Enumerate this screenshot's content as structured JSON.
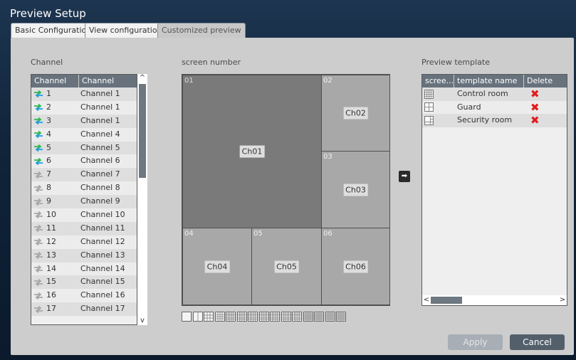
{
  "window": {
    "title": "Preview Setup"
  },
  "tabs": [
    {
      "label": "Basic Configuration",
      "active": false
    },
    {
      "label": "View configuration",
      "active": false
    },
    {
      "label": "Customized preview",
      "active": true
    }
  ],
  "channel_panel": {
    "label": "Channel",
    "columns": [
      "Channel",
      "Channel"
    ],
    "rows": [
      {
        "num": "1",
        "name": "Channel 1",
        "online": true
      },
      {
        "num": "2",
        "name": "Channel 1",
        "online": true
      },
      {
        "num": "3",
        "name": "Channel 1",
        "online": true
      },
      {
        "num": "4",
        "name": "Channel 4",
        "online": true
      },
      {
        "num": "5",
        "name": "Channel 5",
        "online": true
      },
      {
        "num": "6",
        "name": "Channel 6",
        "online": true
      },
      {
        "num": "7",
        "name": "Channel 7",
        "online": false
      },
      {
        "num": "8",
        "name": "Channel 8",
        "online": false
      },
      {
        "num": "9",
        "name": "Channel 9",
        "online": false
      },
      {
        "num": "10",
        "name": "Channel 10",
        "online": false
      },
      {
        "num": "11",
        "name": "Channel 11",
        "online": false
      },
      {
        "num": "12",
        "name": "Channel 12",
        "online": false
      },
      {
        "num": "13",
        "name": "Channel 13",
        "online": false
      },
      {
        "num": "14",
        "name": "Channel 14",
        "online": false
      },
      {
        "num": "15",
        "name": "Channel 15",
        "online": false
      },
      {
        "num": "16",
        "name": "Channel 16",
        "online": false
      },
      {
        "num": "17",
        "name": "Channel 17",
        "online": false
      }
    ]
  },
  "screen_panel": {
    "label": "screen number",
    "cells": [
      {
        "num": "01",
        "ch": "Ch01"
      },
      {
        "num": "02",
        "ch": "Ch02"
      },
      {
        "num": "03",
        "ch": "Ch03"
      },
      {
        "num": "04",
        "ch": "Ch04"
      },
      {
        "num": "05",
        "ch": "Ch05"
      },
      {
        "num": "06",
        "ch": "Ch06"
      }
    ],
    "layout_count": 15
  },
  "template_panel": {
    "label": "Preview template",
    "columns": [
      "scree...",
      "template name",
      "Delete"
    ],
    "rows": [
      {
        "icon": "grid-layout-icon",
        "name": "Control room",
        "delete": "✖"
      },
      {
        "icon": "quad-layout-icon",
        "name": "Guard",
        "delete": "✖"
      },
      {
        "icon": "split-layout-icon",
        "name": "Security room",
        "delete": "✖"
      }
    ]
  },
  "buttons": {
    "apply": "Apply",
    "cancel": "Cancel"
  },
  "colors": {
    "online_arrow": "#1e9fe0",
    "online_arrow2": "#2fb84a",
    "offline_arrow": "#a8a8a8",
    "delete": "#e11c1c"
  }
}
